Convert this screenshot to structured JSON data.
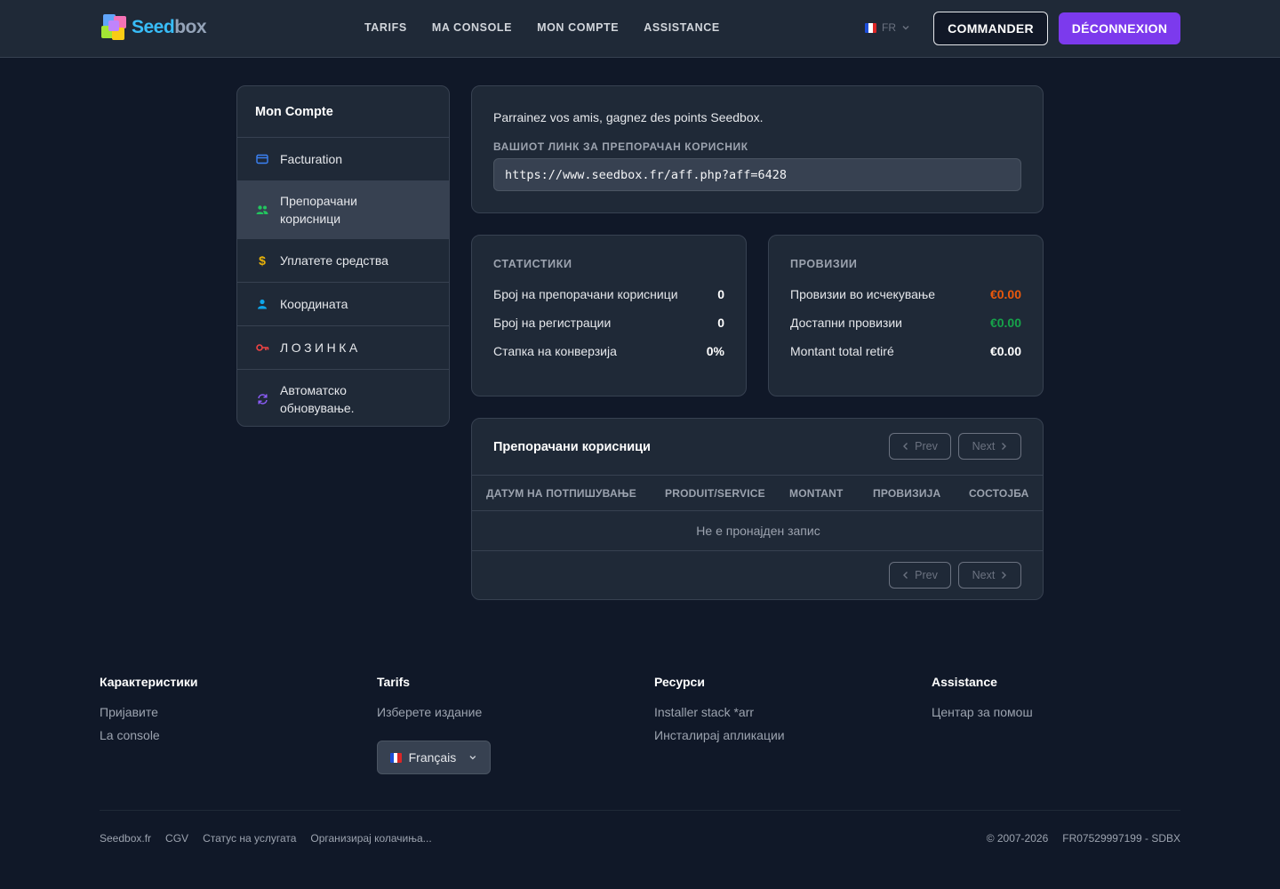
{
  "header": {
    "logo_text_a": "Seed",
    "logo_text_b": "box",
    "nav": [
      "TARIFS",
      "MA CONSOLE",
      "MON COMPTE",
      "ASSISTANCE"
    ],
    "lang_code": "FR",
    "commander_label": "COMMANDER",
    "deconnexion_label": "DÉCONNEXION",
    "accent_color": "#7c3aed"
  },
  "sidebar": {
    "title": "Mon Compte",
    "items": [
      {
        "label": "Facturation",
        "icon": "credit-card-icon",
        "color": "#3b82f6"
      },
      {
        "label": "Препорачани корисници",
        "icon": "users-icon",
        "color": "#22c55e"
      },
      {
        "label": "Уплатете средства",
        "icon": "dollar-icon",
        "color": "#eab308"
      },
      {
        "label": "Координата",
        "icon": "user-icon",
        "color": "#0ea5e9"
      },
      {
        "label": "ЛОЗИНКА",
        "icon": "key-icon",
        "color": "#ef4444"
      },
      {
        "label": "Автоматско обновување.",
        "icon": "refresh-icon",
        "color": "#8b5cf6"
      }
    ],
    "active_index": 1
  },
  "referral": {
    "intro": "Parrainez vos amis, gagnez des points Seedbox.",
    "link_label": "ВАШИОТ ЛИНК ЗА ПРЕПОРАЧАН КОРИСНИК",
    "link_value": "https://www.seedbox.fr/aff.php?aff=6428"
  },
  "stats": {
    "title": "СТАТИСТИКИ",
    "rows": [
      {
        "label": "Број на препорачани корисници",
        "value": "0"
      },
      {
        "label": "Број на регистрации",
        "value": "0"
      },
      {
        "label": "Стапка на конверзија",
        "value": "0%"
      }
    ]
  },
  "commissions": {
    "title": "ПРОВИЗИИ",
    "rows": [
      {
        "label": "Провизии во исчекување",
        "value": "€0.00",
        "color": "#ea580c"
      },
      {
        "label": "Достапни провизии",
        "value": "€0.00",
        "color": "#16a34a"
      },
      {
        "label": "Montant total retiré",
        "value": "€0.00",
        "color": "#ffffff"
      }
    ]
  },
  "referrals_table": {
    "title": "Препорачани корисници",
    "prev_label": "Prev",
    "next_label": "Next",
    "columns": [
      "ДАТУМ НА ПОТПИШУВАЊЕ",
      "PRODUIT/SERVICE",
      "MONTANT",
      "ПРОВИЗИЈА",
      "СОСТОЈБА"
    ],
    "empty_text": "Не е пронајден запис"
  },
  "footer": {
    "columns": [
      {
        "title": "Карактеристики",
        "links": [
          "Пријавите",
          "La console"
        ]
      },
      {
        "title": "Tarifs",
        "links": [
          "Изберете издание"
        ]
      },
      {
        "title": "Ресурси",
        "links": [
          "Installer stack *arr",
          "Инсталирај апликации"
        ]
      },
      {
        "title": "Assistance",
        "links": [
          "Центар за помош"
        ]
      }
    ],
    "language_select": "Français",
    "bottom_links": [
      "Seedbox.fr",
      "CGV",
      "Статус на услугата",
      "Организирај колачиња..."
    ],
    "copyright": "© 2007-2026",
    "company_id": "FR07529997199 - SDBX"
  }
}
